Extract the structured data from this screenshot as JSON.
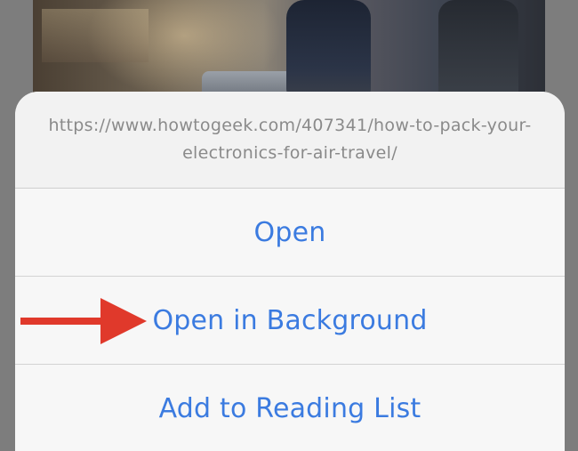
{
  "sheet": {
    "url": "https://www.howtogeek.com/407341/how-to-pack-your-electronics-for-air-travel/",
    "actions": [
      {
        "label": "Open"
      },
      {
        "label": "Open in Background"
      },
      {
        "label": "Add to Reading List"
      }
    ]
  },
  "colors": {
    "action_text": "#3b7be0",
    "url_text": "#8a8a8a",
    "arrow": "#e0392b"
  },
  "icons": {
    "annotation": "red-arrow-icon"
  }
}
